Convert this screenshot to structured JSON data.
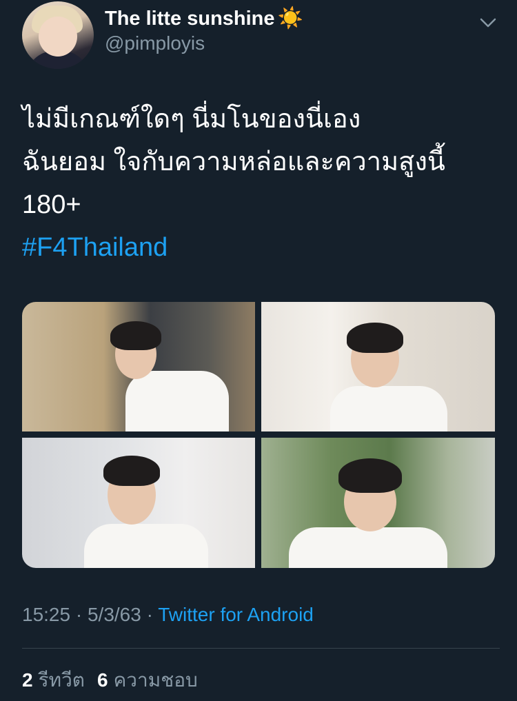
{
  "author": {
    "display_name": "The litte sunshine",
    "emoji": "☀️",
    "handle": "@pimployis"
  },
  "icons": {
    "menu": "chevron-down-icon",
    "sun": "sun-emoji-icon"
  },
  "tweet": {
    "lines": [
      "ไม่มีเกณฑ์ใดๆ นี่มโนของนี่เอง",
      "ฉันยอม ใจกับความหล่อและความสูงนี้",
      "180+"
    ],
    "hashtag": "#F4Thailand"
  },
  "meta": {
    "time": "15:25",
    "sep1": " · ",
    "date": "5/3/63",
    "sep2": " · ",
    "source": "Twitter for Android"
  },
  "stats": {
    "retweets_count": "2",
    "retweets_label": "รีทวีต",
    "likes_count": "6",
    "likes_label": "ความชอบ"
  },
  "colors": {
    "background": "#15202b",
    "link": "#1da1f2",
    "secondary_text": "#8899a6",
    "divider": "#38444d"
  }
}
